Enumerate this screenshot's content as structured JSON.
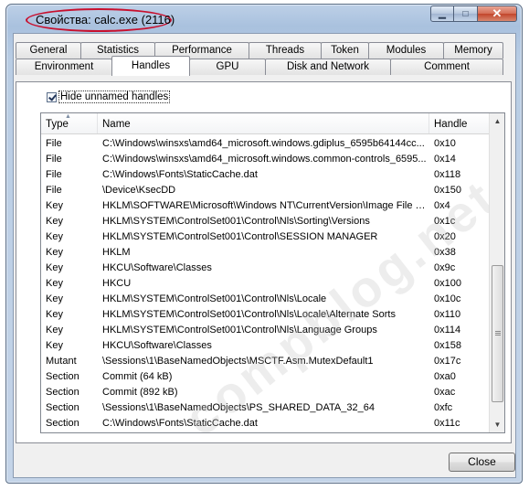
{
  "window": {
    "title": "Свойства: calc.exe (2116)",
    "caption": {
      "minimize": "▁",
      "maximize": "□",
      "close": "✕"
    }
  },
  "tabs": {
    "top_row": [
      "General",
      "Statistics",
      "Performance",
      "Threads",
      "Token",
      "Modules",
      "Memory"
    ],
    "bottom_row": [
      "Environment",
      "Handles",
      "GPU",
      "Disk and Network",
      "Comment"
    ],
    "active": "Handles"
  },
  "handles": {
    "hide_unnamed_label": "Hide unnamed handles",
    "hide_unnamed_checked": true,
    "columns": [
      "Type",
      "Name",
      "Handle"
    ],
    "sort_arrow": "▲",
    "rows": [
      [
        "File",
        "C:\\Windows\\winsxs\\amd64_microsoft.windows.gdiplus_6595b64144cc...",
        "0x10"
      ],
      [
        "File",
        "C:\\Windows\\winsxs\\amd64_microsoft.windows.common-controls_6595...",
        "0x14"
      ],
      [
        "File",
        "C:\\Windows\\Fonts\\StaticCache.dat",
        "0x118"
      ],
      [
        "File",
        "\\Device\\KsecDD",
        "0x150"
      ],
      [
        "Key",
        "HKLM\\SOFTWARE\\Microsoft\\Windows NT\\CurrentVersion\\Image File E...",
        "0x4"
      ],
      [
        "Key",
        "HKLM\\SYSTEM\\ControlSet001\\Control\\Nls\\Sorting\\Versions",
        "0x1c"
      ],
      [
        "Key",
        "HKLM\\SYSTEM\\ControlSet001\\Control\\SESSION MANAGER",
        "0x20"
      ],
      [
        "Key",
        "HKLM",
        "0x38"
      ],
      [
        "Key",
        "HKCU\\Software\\Classes",
        "0x9c"
      ],
      [
        "Key",
        "HKCU",
        "0x100"
      ],
      [
        "Key",
        "HKLM\\SYSTEM\\ControlSet001\\Control\\Nls\\Locale",
        "0x10c"
      ],
      [
        "Key",
        "HKLM\\SYSTEM\\ControlSet001\\Control\\Nls\\Locale\\Alternate Sorts",
        "0x110"
      ],
      [
        "Key",
        "HKLM\\SYSTEM\\ControlSet001\\Control\\Nls\\Language Groups",
        "0x114"
      ],
      [
        "Key",
        "HKCU\\Software\\Classes",
        "0x158"
      ],
      [
        "Mutant",
        "\\Sessions\\1\\BaseNamedObjects\\MSCTF.Asm.MutexDefault1",
        "0x17c"
      ],
      [
        "Section",
        "Commit (64 kB)",
        "0xa0"
      ],
      [
        "Section",
        "Commit (892 kB)",
        "0xac"
      ],
      [
        "Section",
        "\\Sessions\\1\\BaseNamedObjects\\PS_SHARED_DATA_32_64",
        "0xfc"
      ],
      [
        "Section",
        "C:\\Windows\\Fonts\\StaticCache.dat",
        "0x11c"
      ]
    ],
    "scroll": {
      "up": "▲",
      "down": "▼"
    }
  },
  "watermark": "compblog.net",
  "buttons": {
    "close": "Close"
  }
}
